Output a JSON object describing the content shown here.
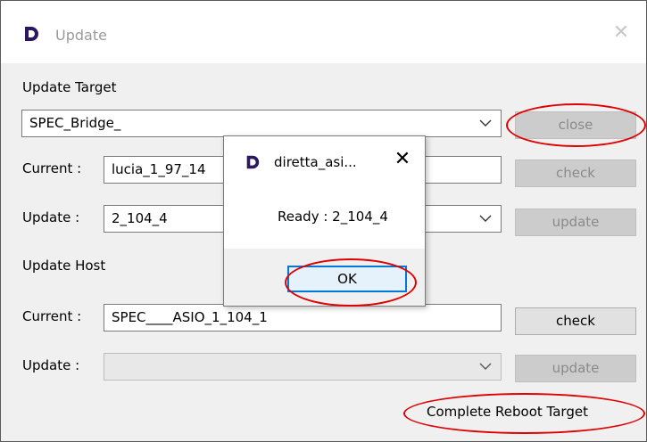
{
  "window": {
    "title": "Update",
    "close_glyph": "✕",
    "icon": "app-logo-icon"
  },
  "update_target": {
    "section_label": "Update Target",
    "target_select": {
      "value": "SPEC_Bridge_"
    },
    "current_label": "Current :",
    "current_value": "lucia_1_97_14",
    "update_label": "Update :",
    "update_value": "2_104_4",
    "close_button": "close",
    "check_button": "check",
    "update_button": "update"
  },
  "update_host": {
    "section_label": "Update Host",
    "current_label": "Current :",
    "current_value": "SPEC____ASIO_1_104_1",
    "update_label": "Update :",
    "update_value": "",
    "check_button": "check",
    "update_button": "update"
  },
  "complete_reboot": "Complete Reboot Target",
  "dialog": {
    "title": "diretta_asi...",
    "close_glyph": "✕",
    "message": "Ready : 2_104_4",
    "ok_button": "OK",
    "icon": "app-logo-icon"
  },
  "colors": {
    "highlight": "#e00000",
    "focus": "#0078d7",
    "logo": "#2a1760"
  }
}
